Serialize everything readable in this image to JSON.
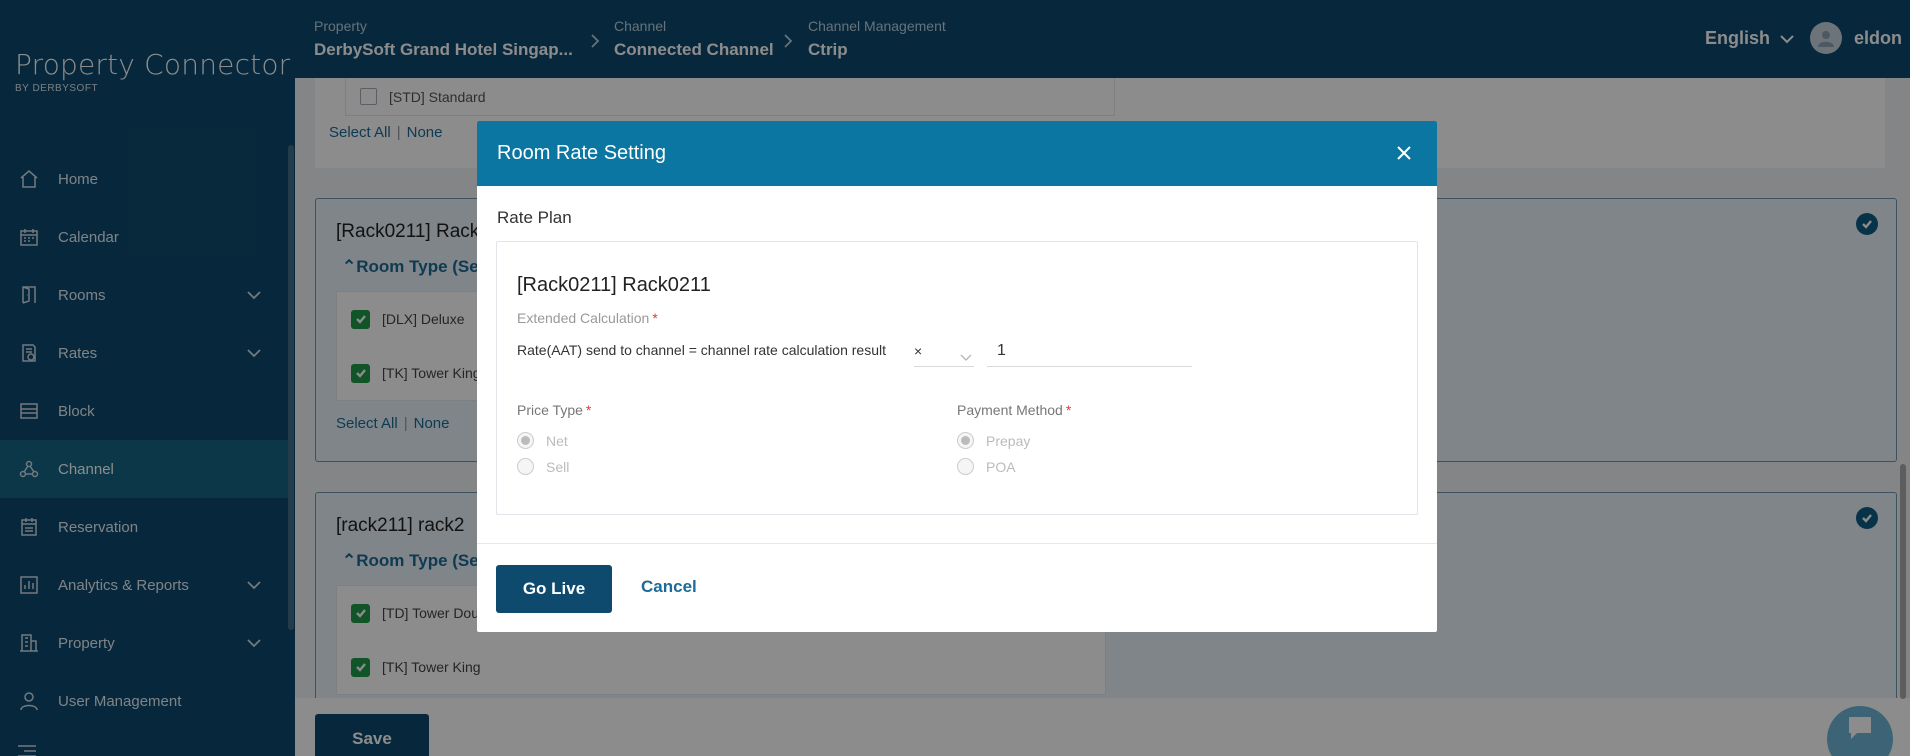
{
  "brand": {
    "title": "Property Connector",
    "subtitle": "BY DERBYSOFT"
  },
  "breadcrumb": [
    {
      "label": "Property",
      "value": "DerbySoft Grand Hotel Singap..."
    },
    {
      "label": "Channel",
      "value": "Connected Channel"
    },
    {
      "label": "Channel Management",
      "value": "Ctrip"
    }
  ],
  "header": {
    "language": "English",
    "username": "eldon"
  },
  "sidebar": {
    "items": [
      {
        "label": "Home",
        "icon": "home-icon"
      },
      {
        "label": "Calendar",
        "icon": "calendar-icon"
      },
      {
        "label": "Rooms",
        "icon": "door-icon",
        "expandable": true
      },
      {
        "label": "Rates",
        "icon": "rates-icon",
        "expandable": true
      },
      {
        "label": "Block",
        "icon": "block-icon"
      },
      {
        "label": "Channel",
        "icon": "channel-icon",
        "active": true
      },
      {
        "label": "Reservation",
        "icon": "reservation-icon"
      },
      {
        "label": "Analytics & Reports",
        "icon": "analytics-icon",
        "expandable": true
      },
      {
        "label": "Property",
        "icon": "building-icon",
        "expandable": true
      },
      {
        "label": "User Management",
        "icon": "user-icon"
      }
    ]
  },
  "background": {
    "std_row": "[STD] Standard",
    "select_all": "Select All",
    "none": "None",
    "cards": [
      {
        "title": "[Rack0211] Rack",
        "subtitle": "Room Type (Se",
        "rows": [
          "[DLX] Deluxe",
          "[TK] Tower King"
        ]
      },
      {
        "title": "[rack211] rack2",
        "subtitle": "Room Type (Se",
        "rows": [
          "[TD] Tower Dou",
          "[TK] Tower King"
        ]
      }
    ],
    "save_label": "Save"
  },
  "modal": {
    "title": "Room Rate Setting",
    "rate_plan_label": "Rate Plan",
    "rate_plan_name": "[Rack0211] Rack0211",
    "extended_calc_label": "Extended Calculation",
    "calc_text": "Rate(AAT) send to channel = channel rate calculation result",
    "operator": "×",
    "value": "1",
    "price_type": {
      "label": "Price Type",
      "options": [
        "Net",
        "Sell"
      ],
      "selected": "Net"
    },
    "payment_method": {
      "label": "Payment Method",
      "options": [
        "Prepay",
        "POA"
      ],
      "selected": "Prepay"
    },
    "go_live_label": "Go Live",
    "cancel_label": "Cancel"
  },
  "colors": {
    "sidebar_bg": "#0e4a6e",
    "modal_header": "#0a76a1",
    "primary_button": "#0e4a6e",
    "link": "#1d6b96",
    "checkbox_checked": "#1e9a4a",
    "required": "#e03a3a"
  }
}
